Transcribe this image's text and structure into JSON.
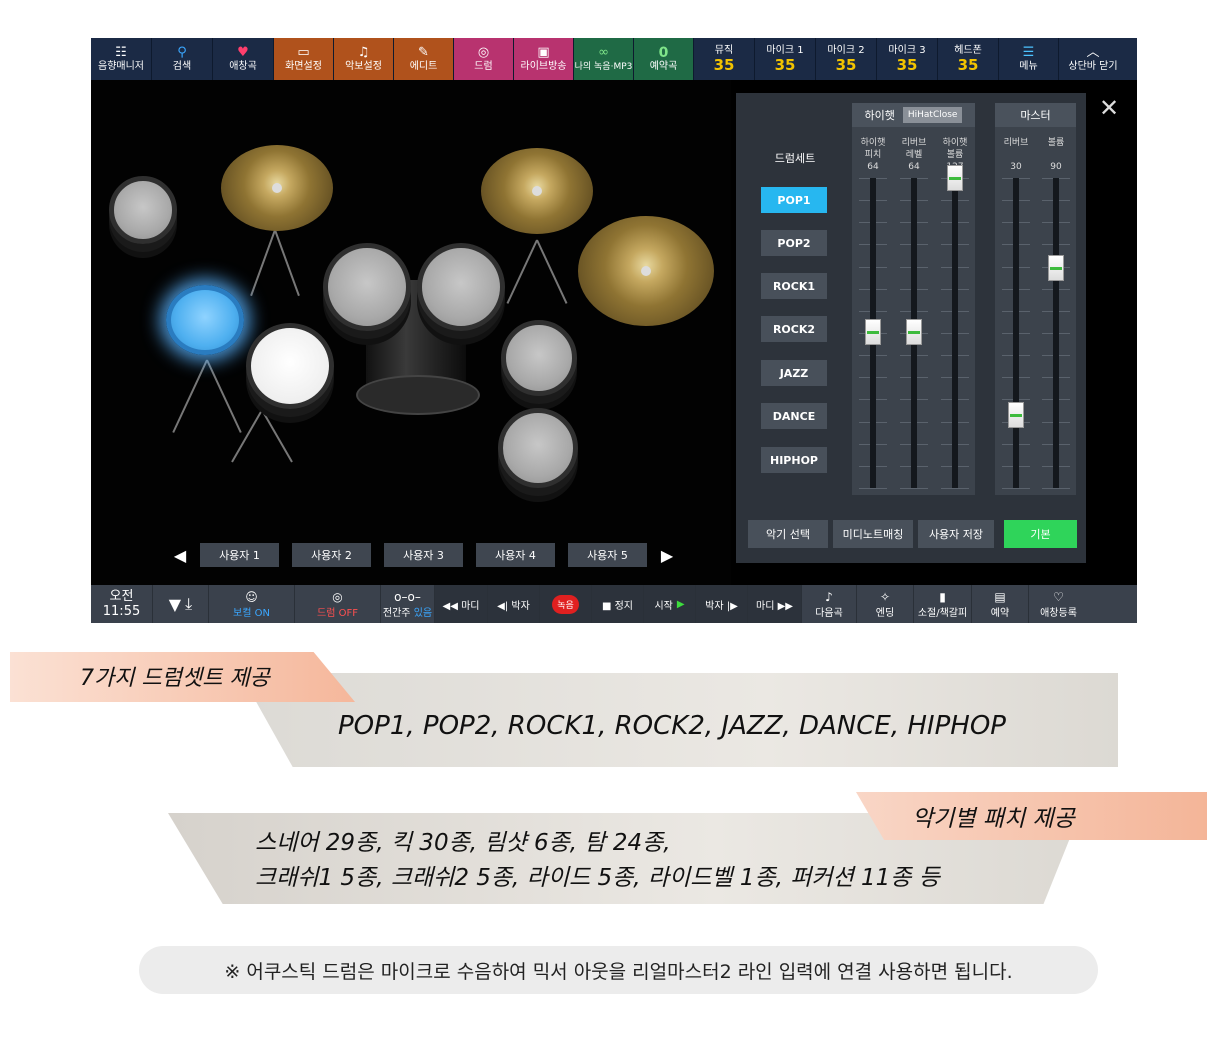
{
  "topbar": {
    "items": [
      {
        "label": "음향매니저",
        "icon": "sliders-icon"
      },
      {
        "label": "검색",
        "icon": "search-icon"
      },
      {
        "label": "애창곡",
        "icon": "heart-icon"
      },
      {
        "label": "화면설정",
        "icon": "monitor-icon"
      },
      {
        "label": "악보설정",
        "icon": "score-icon"
      },
      {
        "label": "에디트",
        "icon": "edit-icon"
      },
      {
        "label": "드럼",
        "icon": "drum-icon"
      },
      {
        "label": "라이브방송",
        "icon": "camera-icon"
      },
      {
        "label": "나의 녹음·MP3",
        "icon": "tape-icon"
      }
    ],
    "reserve": {
      "count": "0",
      "label": "예약곡"
    },
    "levels": [
      {
        "label": "뮤직",
        "value": "35"
      },
      {
        "label": "마이크 1",
        "value": "35"
      },
      {
        "label": "마이크 2",
        "value": "35"
      },
      {
        "label": "마이크 3",
        "value": "35"
      },
      {
        "label": "헤드폰",
        "value": "35"
      }
    ],
    "menu_label": "메뉴",
    "close_label": "상단바 닫기"
  },
  "user_buttons": [
    "사용자 1",
    "사용자 2",
    "사용자 3",
    "사용자 4",
    "사용자 5"
  ],
  "panel": {
    "drumset_title": "드럼세트",
    "drumsets": [
      "POP1",
      "POP2",
      "ROCK1",
      "ROCK2",
      "JAZZ",
      "DANCE",
      "HIPHOP"
    ],
    "active_drumset": "POP1",
    "hihat": {
      "title": "하이햇",
      "tag": "HiHatClose",
      "faders": [
        {
          "label1": "하이햇",
          "label2": "피치",
          "value": 64
        },
        {
          "label1": "리버브",
          "label2": "레벨",
          "value": 64
        },
        {
          "label1": "하이햇",
          "label2": "볼륨",
          "value": 127
        }
      ]
    },
    "master": {
      "title": "마스터",
      "faders": [
        {
          "label1": "리버브",
          "label2": "",
          "value": 30
        },
        {
          "label1": "볼륨",
          "label2": "",
          "value": 90
        }
      ]
    },
    "buttons": {
      "instrument": "악기 선택",
      "midi": "미디노트매칭",
      "save": "사용자 저장",
      "default": "기본"
    }
  },
  "bottombar": {
    "time_label": "오전",
    "time": "11:55",
    "vocal": "보컬 ON",
    "drum": "드럼 OFF",
    "interlude": "전간주",
    "interlude_state": "있음",
    "prev_bar": "◀◀ 마디",
    "prev_beat": "◀| 박자",
    "record": "녹음",
    "stop": "■ 정지",
    "start": "시작",
    "next_beat": "박자 |▶",
    "next_bar": "마디 ▶▶",
    "next_song": "다음곡",
    "ending": "엔딩",
    "cancel": "소절/책갈피",
    "reserve": "예약",
    "fav_add": "애창등록"
  },
  "banners": {
    "tag1": "7가지 드럼셋트 제공",
    "text1": "POP1, POP2, ROCK1, ROCK2, JAZZ, DANCE, HIPHOP",
    "tag2": "악기별 패치 제공",
    "text2_line1": "스네어 29종, 킥 30종, 림샷 6종, 탐 24종,",
    "text2_line2": "크래쉬1 5종, 크래쉬2 5종, 라이드 5종, 라이드벨 1종, 퍼커션 11종 등",
    "note": "※ 어쿠스틱 드럼은 마이크로 수음하여 믹서 아웃을 리얼마스터2 라인 입력에 연결 사용하면 됩니다."
  },
  "colors": {
    "accent": "#27b7f0",
    "level": "#f2c300",
    "default_btn": "#2fd45a",
    "tag": "#f7c3ac"
  }
}
